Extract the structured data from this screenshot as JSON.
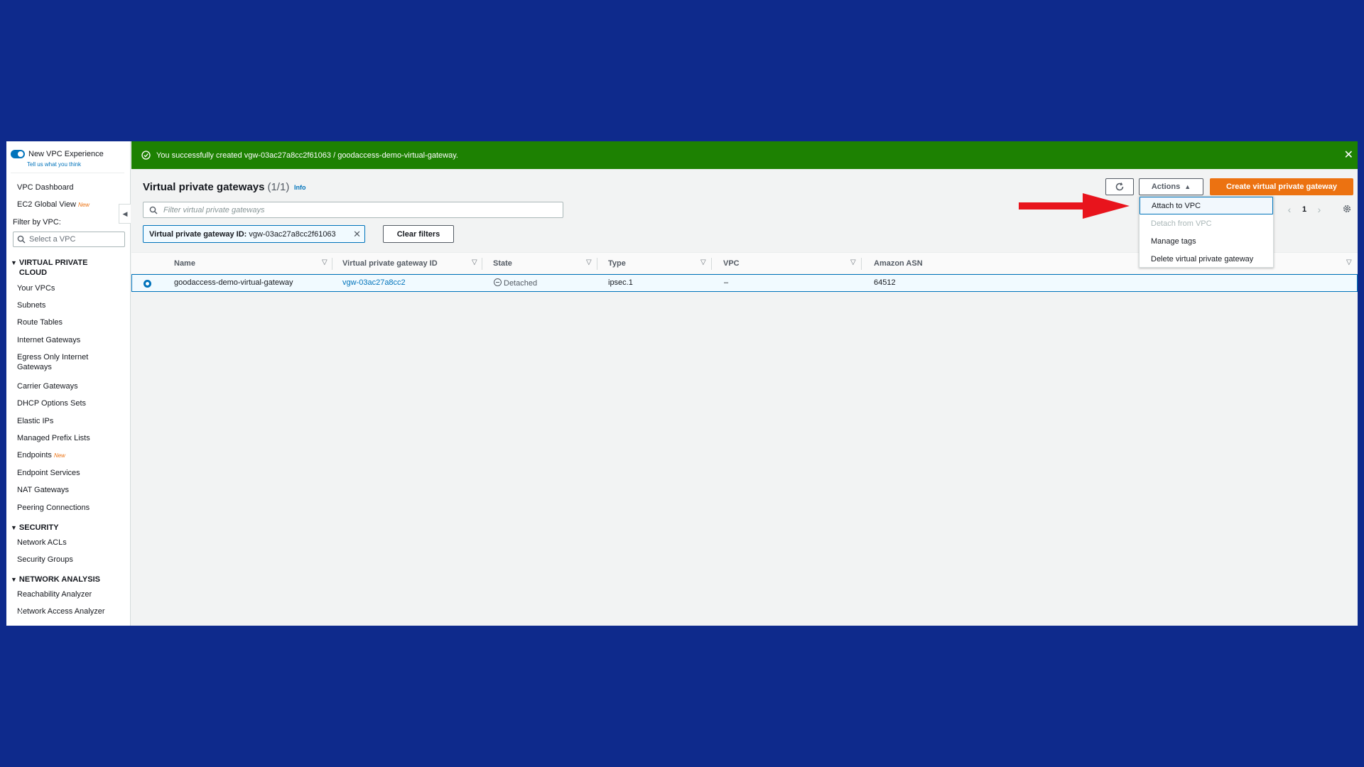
{
  "sidebar": {
    "new_experience_label": "New VPC Experience",
    "feedback_link": "Tell us what you think",
    "items_top": [
      {
        "label": "VPC Dashboard",
        "badge": ""
      },
      {
        "label": "EC2 Global View",
        "badge": "New"
      }
    ],
    "filter_label": "Filter by VPC:",
    "filter_placeholder": "Select a VPC",
    "section_vpc": "VIRTUAL PRIVATE CLOUD",
    "vpc_items": [
      {
        "label": "Your VPCs"
      },
      {
        "label": "Subnets"
      },
      {
        "label": "Route Tables"
      },
      {
        "label": "Internet Gateways"
      },
      {
        "label": "Egress Only Internet Gateways"
      },
      {
        "label": "Carrier Gateways"
      },
      {
        "label": "DHCP Options Sets"
      },
      {
        "label": "Elastic IPs"
      },
      {
        "label": "Managed Prefix Lists"
      },
      {
        "label": "Endpoints",
        "badge": "New"
      },
      {
        "label": "Endpoint Services"
      },
      {
        "label": "NAT Gateways"
      },
      {
        "label": "Peering Connections"
      }
    ],
    "section_security": "SECURITY",
    "security_items": [
      {
        "label": "Network ACLs"
      },
      {
        "label": "Security Groups"
      }
    ],
    "section_network": "NETWORK ANALYSIS",
    "network_items": [
      {
        "label": "Reachability Analyzer"
      },
      {
        "label": "Network Access Analyzer"
      }
    ]
  },
  "flash": {
    "message": "You successfully created vgw-03ac27a8cc2f61063 / goodaccess-demo-virtual-gateway."
  },
  "header": {
    "title": "Virtual private gateways",
    "count": "(1/1)",
    "info": "Info",
    "actions_label": "Actions",
    "create_label": "Create virtual private gateway"
  },
  "search": {
    "placeholder": "Filter virtual private gateways"
  },
  "filter_token": {
    "key": "Virtual private gateway ID:",
    "value": "vgw-03ac27a8cc2f61063"
  },
  "clear_filters": "Clear filters",
  "pagination": {
    "page": "1"
  },
  "table": {
    "columns": [
      "Name",
      "Virtual private gateway ID",
      "State",
      "Type",
      "VPC",
      "Amazon ASN"
    ],
    "rows": [
      {
        "name": "goodaccess-demo-virtual-gateway",
        "id": "vgw-03ac27a8cc2",
        "state": "Detached",
        "type": "ipsec.1",
        "vpc": "–",
        "asn": "64512"
      }
    ]
  },
  "actions_menu": {
    "items": [
      {
        "label": "Attach to VPC",
        "state": "highlighted"
      },
      {
        "label": "Detach from VPC",
        "state": "disabled"
      },
      {
        "label": "Manage tags",
        "state": "enabled"
      },
      {
        "label": "Delete virtual private gateway",
        "state": "enabled"
      }
    ]
  },
  "colors": {
    "background": "#0e2a8c",
    "flash_success": "#1d8102",
    "primary_button": "#ec7211",
    "link": "#0073bb",
    "annotation_arrow": "#e8141c"
  }
}
